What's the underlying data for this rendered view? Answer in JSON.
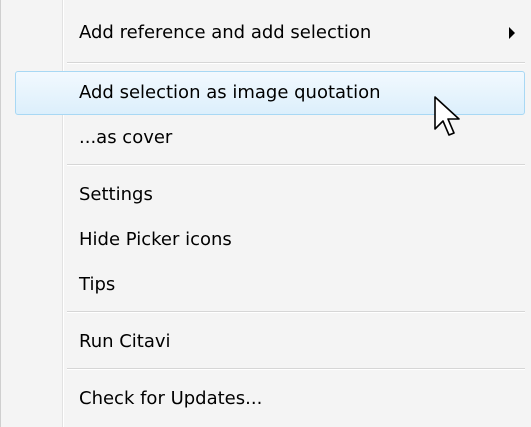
{
  "menu": {
    "items": [
      {
        "label": "Add reference and add selection",
        "has_submenu": true
      },
      {
        "label": "Add selection as image quotation",
        "highlighted": true
      },
      {
        "label": "...as cover"
      },
      {
        "label": "Settings"
      },
      {
        "label": "Hide Picker icons"
      },
      {
        "label": "Tips"
      },
      {
        "label": "Run Citavi"
      },
      {
        "label": "Check for Updates..."
      }
    ]
  },
  "icons": {
    "submenu": "submenu-arrow-icon",
    "cursor": "mouse-pointer-icon"
  },
  "colors": {
    "highlight_border": "#a8d8f4",
    "highlight_fill": "#dceffc",
    "menu_background": "#f4f4f4"
  }
}
